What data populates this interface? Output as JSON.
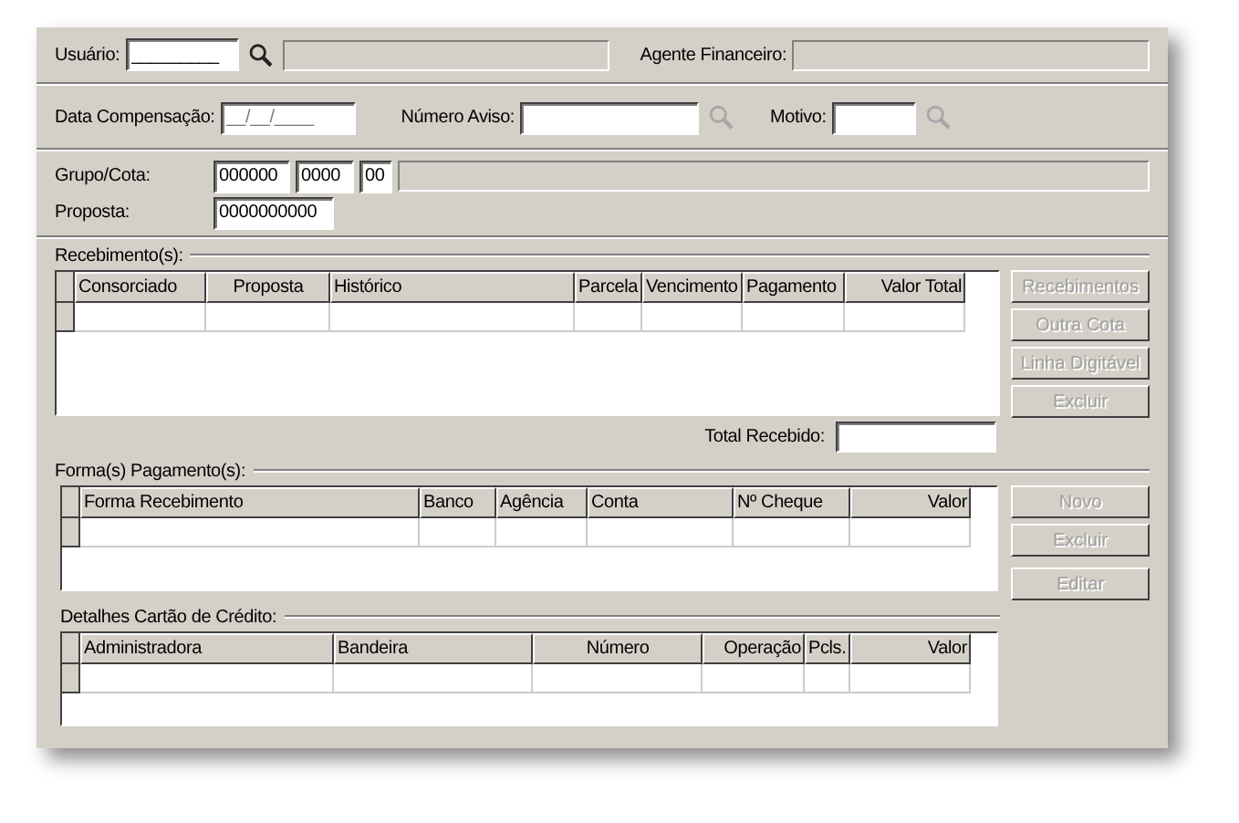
{
  "usuario": {
    "label": "Usuário:",
    "value": "_________",
    "search_disabled": false
  },
  "agente": {
    "label": "Agente Financeiro:"
  },
  "data_compensacao": {
    "label": "Data Compensação:",
    "placeholder": "__/__/____"
  },
  "numero_aviso": {
    "label": "Número Aviso:",
    "search_disabled": true
  },
  "motivo": {
    "label": "Motivo:",
    "search_disabled": true
  },
  "grupo_cota": {
    "label": "Grupo/Cota:",
    "grupo": "000000",
    "cota": "0000",
    "digito": "00"
  },
  "proposta": {
    "label": "Proposta:",
    "value": "0000000000"
  },
  "recebimentos": {
    "title": "Recebimento(s):",
    "columns": [
      {
        "label": "Consorciado"
      },
      {
        "label": "Proposta"
      },
      {
        "label": "Histórico"
      },
      {
        "label": "Parcela"
      },
      {
        "label": "Vencimento"
      },
      {
        "label": "Pagamento"
      },
      {
        "label": "Valor Total"
      }
    ],
    "buttons": [
      {
        "label": "Recebimentos",
        "disabled": true
      },
      {
        "label": "Outra Cota",
        "disabled": true
      },
      {
        "label": "Linha Digitável",
        "disabled": true
      },
      {
        "label": "Excluir",
        "disabled": true
      }
    ],
    "total_label": "Total Recebido:"
  },
  "pagamentos": {
    "title": "Forma(s) Pagamento(s):",
    "columns": [
      {
        "label": "Forma Recebimento"
      },
      {
        "label": "Banco"
      },
      {
        "label": "Agência"
      },
      {
        "label": "Conta"
      },
      {
        "label": "Nº Cheque"
      },
      {
        "label": "Valor"
      }
    ],
    "buttons": [
      {
        "label": "Novo",
        "disabled": true
      },
      {
        "label": "Excluir",
        "disabled": true
      },
      {
        "label": "Editar",
        "disabled": true
      }
    ]
  },
  "cartao": {
    "title": "Detalhes Cartão de Crédito:",
    "columns": [
      {
        "label": "Administradora"
      },
      {
        "label": "Bandeira"
      },
      {
        "label": "Número"
      },
      {
        "label": "Operação"
      },
      {
        "label": "Pcls."
      },
      {
        "label": "Valor"
      }
    ]
  }
}
